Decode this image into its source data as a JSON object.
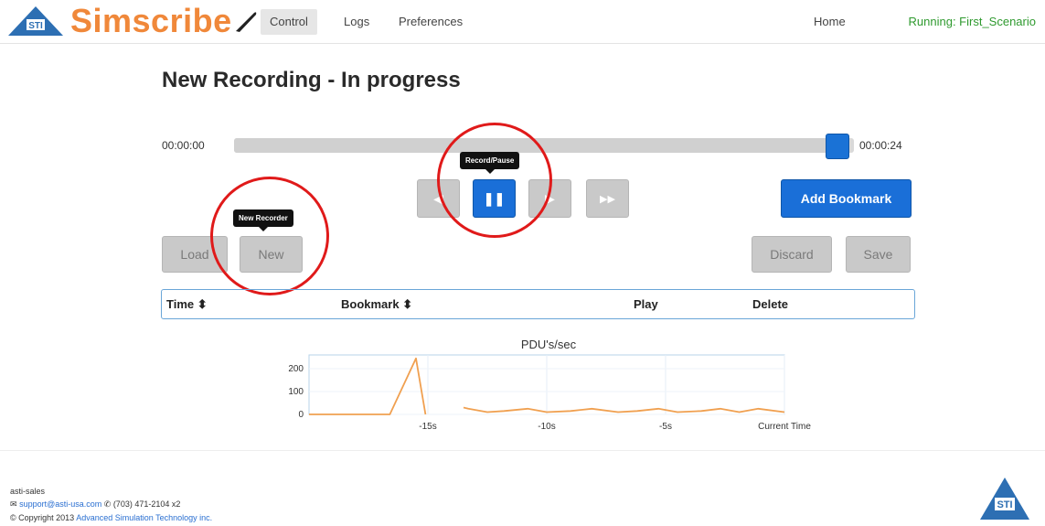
{
  "app": {
    "brand": "Simscribe",
    "nav": [
      {
        "label": "Control",
        "active": true
      },
      {
        "label": "Logs"
      },
      {
        "label": "Preferences"
      }
    ],
    "home_label": "Home",
    "status": "Running: First_Scenario"
  },
  "page": {
    "title": "New Recording - In progress"
  },
  "player": {
    "start_time": "00:00:00",
    "end_time": "00:00:24",
    "progress_fraction": 0.99,
    "tooltip_record": "Record/Pause",
    "tooltip_new": "New Recorder"
  },
  "buttons": {
    "add_bookmark": "Add Bookmark",
    "load": "Load",
    "new": "New",
    "discard": "Discard",
    "save": "Save"
  },
  "table": {
    "columns": [
      "Time ⬍",
      "Bookmark ⬍",
      "Play",
      "Delete"
    ]
  },
  "chart_data": {
    "type": "line",
    "title": "PDU's/sec",
    "x_tick_labels": [
      "-15s",
      "-10s",
      "-5s",
      "Current Time"
    ],
    "y_tick_labels": [
      "200",
      "100",
      "0"
    ],
    "ylim": [
      0,
      260
    ],
    "xlim": [
      -20,
      0
    ],
    "series": [
      {
        "color": "#f0a050",
        "x": [
          -20,
          -16.6,
          -15.5,
          -15.1,
          -15.0,
          -13.8,
          -13.5,
          -13.3,
          -12.5,
          -11.8,
          -10.8,
          -10.0,
          -9.0,
          -8.1,
          -7.0,
          -6.2,
          -5.3,
          -4.5,
          -3.5,
          -2.7,
          -1.9,
          -1.1,
          0
        ],
        "y": [
          0,
          0,
          245,
          0,
          null,
          null,
          30,
          25,
          10,
          15,
          25,
          10,
          15,
          25,
          10,
          15,
          25,
          10,
          15,
          25,
          10,
          25,
          10
        ]
      }
    ],
    "grid": true
  },
  "footer": {
    "account": "asti-sales",
    "email": "support@asti-usa.com",
    "phone": "(703) 471-2104 x2",
    "copyright_prefix": "© Copyright 2013",
    "company": "Advanced Simulation Technology inc."
  },
  "icons": {
    "logo": "asti-logo-icon",
    "envelope": "envelope-icon",
    "phone": "phone-icon",
    "pause": "pause-icon",
    "rewind": "rewind-icon",
    "play": "play-icon",
    "fast_forward": "fast-forward-icon"
  },
  "colors": {
    "brand_orange": "#f0883a",
    "status_green": "#2f9a2f",
    "primary_blue": "#1a6fd8",
    "annotation_red": "#e01a1a",
    "chart_line": "#f0a050"
  }
}
